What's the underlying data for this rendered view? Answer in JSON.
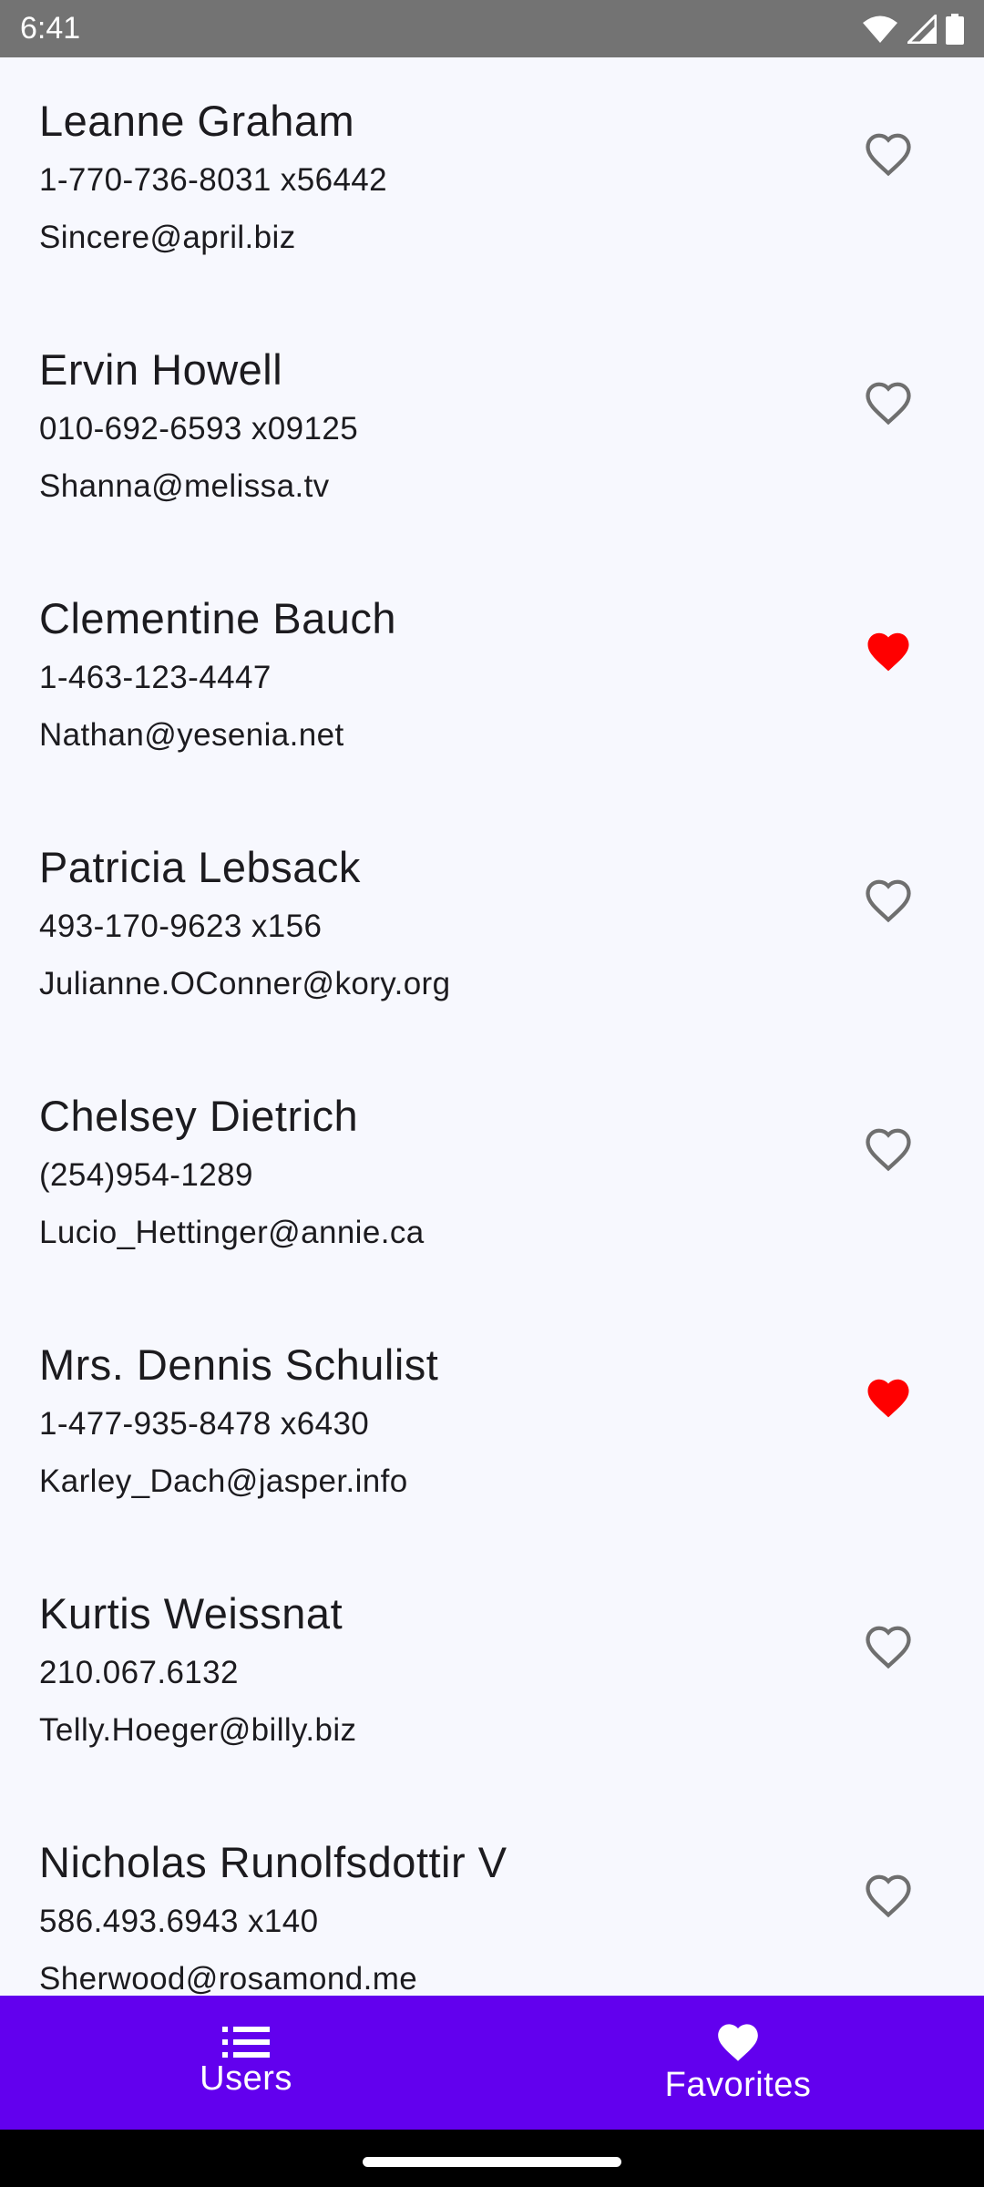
{
  "status_bar": {
    "time": "6:41",
    "icons": [
      "wifi-icon",
      "signal-icon",
      "battery-icon"
    ]
  },
  "colors": {
    "accent": "#6200ee",
    "favorite": "#ff0000",
    "heart_outline": "#6f6f6f",
    "status_bar": "#737373",
    "background": "#f7f8fe"
  },
  "users": [
    {
      "name": "Leanne Graham",
      "phone": "1-770-736-8031 x56442",
      "email": "Sincere@april.biz",
      "favorite": false
    },
    {
      "name": "Ervin Howell",
      "phone": "010-692-6593 x09125",
      "email": "Shanna@melissa.tv",
      "favorite": false
    },
    {
      "name": "Clementine Bauch",
      "phone": "1-463-123-4447",
      "email": "Nathan@yesenia.net",
      "favorite": true
    },
    {
      "name": "Patricia Lebsack",
      "phone": "493-170-9623 x156",
      "email": "Julianne.OConner@kory.org",
      "favorite": false
    },
    {
      "name": "Chelsey Dietrich",
      "phone": "(254)954-1289",
      "email": "Lucio_Hettinger@annie.ca",
      "favorite": false
    },
    {
      "name": "Mrs. Dennis Schulist",
      "phone": "1-477-935-8478 x6430",
      "email": "Karley_Dach@jasper.info",
      "favorite": true
    },
    {
      "name": "Kurtis Weissnat",
      "phone": "210.067.6132",
      "email": "Telly.Hoeger@billy.biz",
      "favorite": false
    },
    {
      "name": "Nicholas Runolfsdottir V",
      "phone": "586.493.6943 x140",
      "email": "Sherwood@rosamond.me",
      "favorite": false
    }
  ],
  "bottom_nav": {
    "items": [
      {
        "label": "Users",
        "icon": "list-icon"
      },
      {
        "label": "Favorites",
        "icon": "heart-icon"
      }
    ]
  }
}
